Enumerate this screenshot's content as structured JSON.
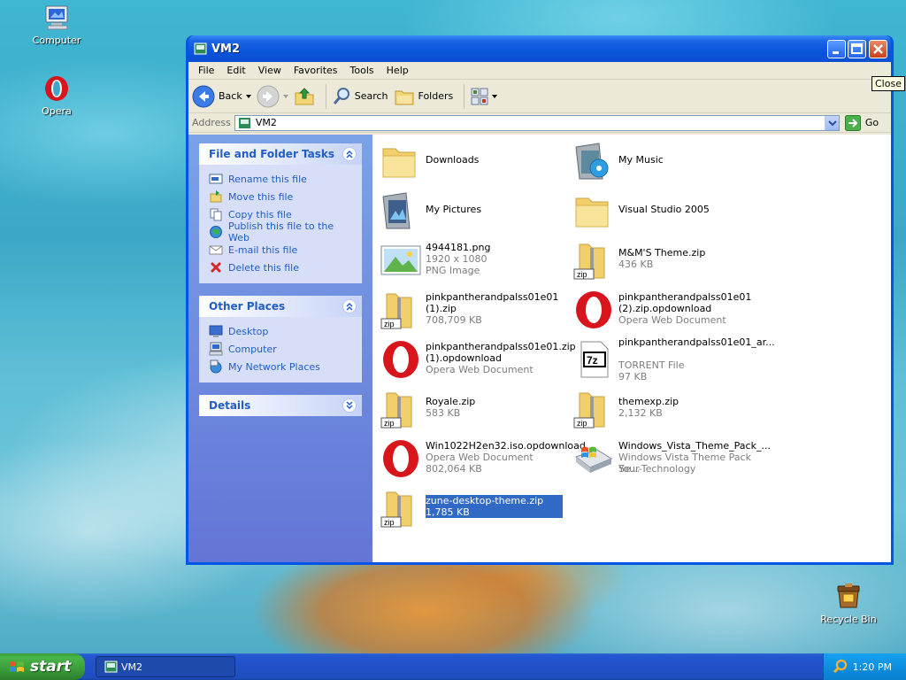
{
  "desktop": {
    "icons": [
      {
        "label": "Computer"
      },
      {
        "label": "Opera"
      },
      {
        "label": "Recycle Bin"
      }
    ]
  },
  "window": {
    "title": "VM2",
    "menu": [
      "File",
      "Edit",
      "View",
      "Favorites",
      "Tools",
      "Help"
    ],
    "toolbar": {
      "back": "Back",
      "search": "Search",
      "folders": "Folders"
    },
    "address": {
      "label": "Address",
      "value": "VM2",
      "go": "Go"
    },
    "tooltip": "Close"
  },
  "taskpane": {
    "file_tasks": {
      "title": "File and Folder Tasks",
      "items": [
        "Rename this file",
        "Move this file",
        "Copy this file",
        "Publish this file to the Web",
        "E-mail this file",
        "Delete this file"
      ]
    },
    "other_places": {
      "title": "Other Places",
      "items": [
        "Desktop",
        "Computer",
        "My Network Places"
      ]
    },
    "details": {
      "title": "Details"
    }
  },
  "files": [
    {
      "icon": "folder-icon",
      "name": "Downloads",
      "sub": []
    },
    {
      "icon": "music-folder-icon",
      "name": "My Music",
      "sub": []
    },
    {
      "icon": "pictures-folder-icon",
      "name": "My Pictures",
      "sub": []
    },
    {
      "icon": "folder-icon",
      "name": "Visual Studio 2005",
      "sub": []
    },
    {
      "icon": "image-file-icon",
      "name": "4944181.png",
      "sub": [
        "1920 x 1080",
        "PNG Image"
      ]
    },
    {
      "icon": "zip-icon",
      "name": "M&M'S Theme.zip",
      "sub": [
        "436 KB"
      ]
    },
    {
      "icon": "zip-icon",
      "name": "pinkpantherandpalss01e01 (1).zip",
      "sub": [
        "708,709 KB"
      ]
    },
    {
      "icon": "opera-file-icon",
      "name": "pinkpantherandpalss01e01 (2).zip.opdownload",
      "sub": [
        "Opera Web Document"
      ]
    },
    {
      "icon": "opera-file-icon",
      "name": "pinkpantherandpalss01e01.zip (1).opdownload",
      "sub": [
        "Opera Web Document"
      ]
    },
    {
      "icon": "7z-file-icon",
      "name": "pinkpantherandpalss01e01_ar...",
      "sub": [
        "TORRENT File",
        "97 KB"
      ]
    },
    {
      "icon": "zip-icon",
      "name": "Royale.zip",
      "sub": [
        "583 KB"
      ]
    },
    {
      "icon": "zip-icon",
      "name": "themexp.zip",
      "sub": [
        "2,132 KB"
      ]
    },
    {
      "icon": "opera-file-icon",
      "name": "Win1022H2en32.iso.opdownload",
      "sub": [
        "Opera Web Document",
        "802,064 KB"
      ]
    },
    {
      "icon": "theme-pack-icon",
      "name": "Windows_Vista_Theme_Pack_...",
      "sub": [
        "Windows Vista Theme Pack Se...",
        "Your-Technology"
      ]
    },
    {
      "icon": "zip-icon",
      "name": "zune-desktop-theme.zip",
      "sub": [
        "1,785 KB"
      ],
      "selected": true
    }
  ],
  "taskbar": {
    "start": "start",
    "task": "VM2",
    "clock": "1:20 PM"
  },
  "colors": {
    "selection": "#316ac5",
    "taskpane_link": "#215dc6",
    "titlebar": "#0a55db"
  }
}
